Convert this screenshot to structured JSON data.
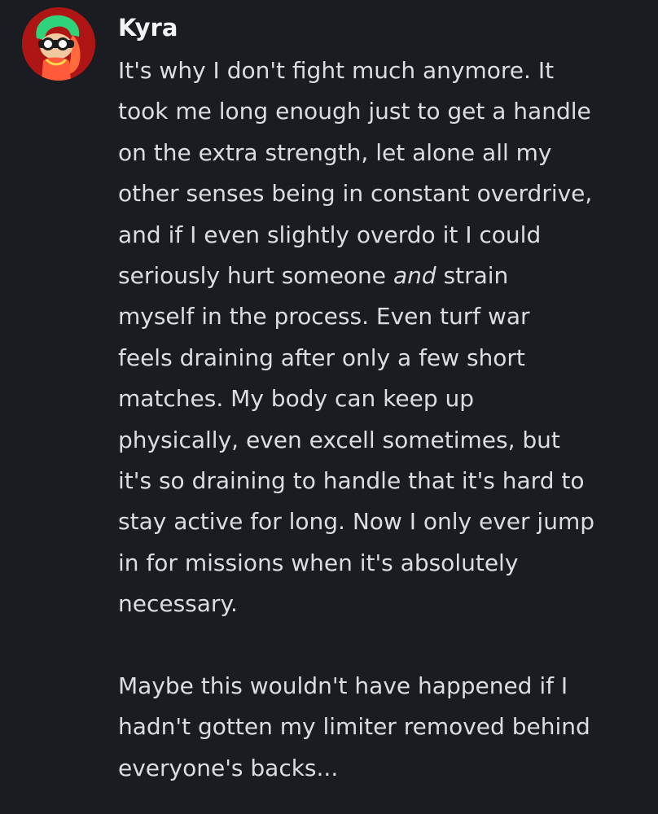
{
  "message": {
    "author": "Kyra",
    "avatar_icon": "inkling-avatar-icon",
    "colors": {
      "background": "#1b1c21",
      "text": "#dbdee1",
      "username": "#f2f3f5",
      "avatar_bg": "#b01515",
      "avatar_accent": "#2fd47a"
    },
    "paragraph1": {
      "l1": "It's why I don't fight much anymore. It",
      "l2": "took me long enough just to get a handle",
      "l3": "on the extra strength, let alone all my",
      "l4": "other senses being in constant overdrive,",
      "l5": "and if I even slightly overdo it I could",
      "l6_pre": "seriously hurt someone ",
      "l6_em": "and",
      "l6_post": " strain",
      "l7": "myself in the process. Even turf war",
      "l8": "feels draining after only a few short",
      "l9": "matches. My body can keep up",
      "l10": "physically, even excell sometimes, but",
      "l11": "it's so draining to handle that it's hard to",
      "l12": "stay active for long. Now I only ever jump",
      "l13": "in for missions when it's absolutely",
      "l14": "necessary."
    },
    "paragraph2": {
      "l1": "Maybe this wouldn't have happened if I",
      "l2": "hadn't gotten my limiter removed behind",
      "l3": "everyone's backs..."
    }
  }
}
